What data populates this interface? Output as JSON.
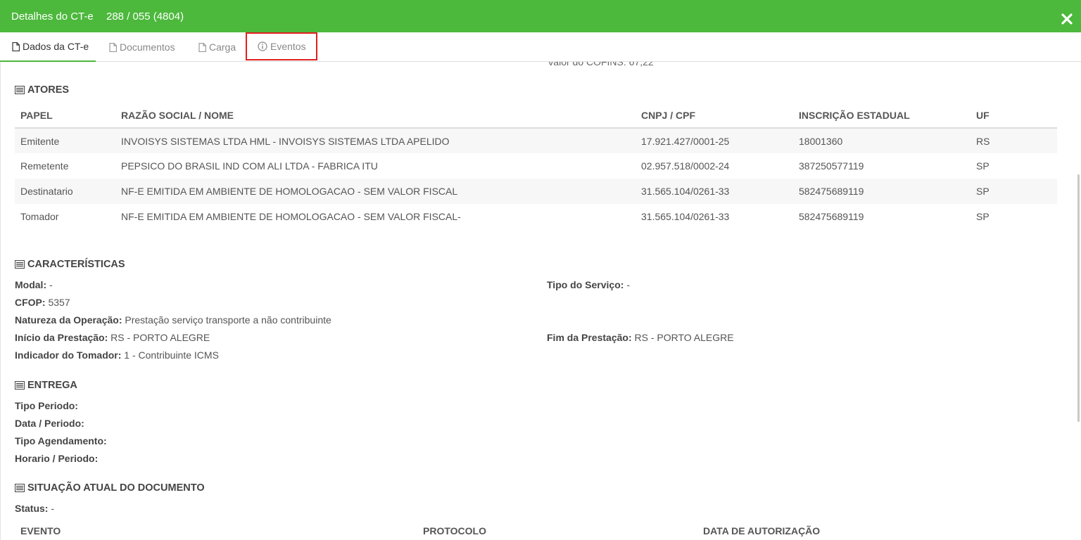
{
  "header": {
    "title": "Detalhes do CT-e",
    "subtitle": "288 / 055 (4804)"
  },
  "tabs": [
    {
      "label": "Dados da CT-e"
    },
    {
      "label": "Documentos"
    },
    {
      "label": "Carga"
    },
    {
      "label": "Eventos"
    }
  ],
  "cut_text": "Valor do COFINS: 67,22",
  "atores": {
    "title": "ATORES",
    "columns": [
      "PAPEL",
      "RAZÃO SOCIAL / NOME",
      "CNPJ / CPF",
      "INSCRIÇÃO ESTADUAL",
      "UF"
    ],
    "rows": [
      [
        "Emitente",
        "INVOISYS SISTEMAS LTDA HML - INVOISYS SISTEMAS LTDA APELIDO",
        "17.921.427/0001-25",
        "18001360",
        "RS"
      ],
      [
        "Remetente",
        "PEPSICO DO BRASIL IND COM ALI LTDA - FABRICA ITU",
        "02.957.518/0002-24",
        "387250577119",
        "SP"
      ],
      [
        "Destinatario",
        "NF-E EMITIDA EM AMBIENTE DE HOMOLOGACAO - SEM VALOR FISCAL",
        "31.565.104/0261-33",
        "582475689119",
        "SP"
      ],
      [
        "Tomador",
        "NF-E EMITIDA EM AMBIENTE DE HOMOLOGACAO - SEM VALOR FISCAL-",
        "31.565.104/0261-33",
        "582475689119",
        "SP"
      ]
    ]
  },
  "caracteristicas": {
    "title": "CARACTERÍSTICAS",
    "modal_label": "Modal:",
    "modal_value": "-",
    "tipo_servico_label": "Tipo do Serviço:",
    "tipo_servico_value": "-",
    "cfop_label": "CFOP:",
    "cfop_value": "5357",
    "natureza_label": "Natureza da Operação:",
    "natureza_value": "Prestação serviço transporte a não contribuinte",
    "inicio_label": "Início da Prestação:",
    "inicio_value": "RS - PORTO ALEGRE",
    "fim_label": "Fim da Prestação:",
    "fim_value": "RS - PORTO ALEGRE",
    "indicador_label": "Indicador do Tomador:",
    "indicador_value": "1 - Contribuinte ICMS"
  },
  "entrega": {
    "title": "ENTREGA",
    "tipo_periodo_label": "Tipo Periodo:",
    "data_periodo_label": "Data / Periodo:",
    "tipo_agendamento_label": "Tipo Agendamento:",
    "horario_periodo_label": "Horario / Periodo:"
  },
  "situacao": {
    "title": "SITUAÇÃO ATUAL DO DOCUMENTO",
    "status_label": "Status:",
    "status_value": "-",
    "columns": [
      "EVENTO",
      "PROTOCOLO",
      "DATA DE AUTORIZAÇÃO"
    ]
  },
  "colors": {
    "header_green": "#4cb83c",
    "highlight_red": "#e02020"
  }
}
